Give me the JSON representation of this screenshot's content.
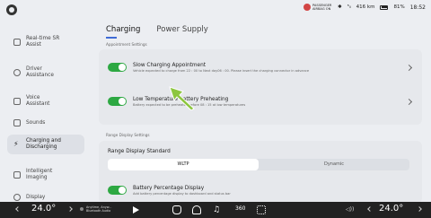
{
  "status": {
    "airbag_line1": "PASSENGER",
    "airbag_line2": "AIRBAG ON",
    "bluetooth": "✱",
    "signal": "⁵ᵢₗ",
    "range": "416 km",
    "battery": "81%",
    "time": "18:52",
    "colors": {
      "airbag": "#d24545"
    }
  },
  "sidebar": {
    "items": [
      {
        "label": "Real-time SR\nAssist",
        "icon": "car-sr-icon"
      },
      {
        "label": "Driver\nAssistance",
        "icon": "steering-wheel-icon"
      },
      {
        "label": "Voice\nAssistant",
        "icon": "voice-assistant-icon"
      },
      {
        "label": "Sounds",
        "icon": "speaker-icon"
      },
      {
        "label": "Charging and\nDischarging",
        "icon": "charging-icon"
      },
      {
        "label": "Intelligent\nImaging",
        "icon": "camera-icon"
      },
      {
        "label": "Display",
        "icon": "brightness-icon"
      }
    ],
    "active_index": 4
  },
  "tabs": [
    {
      "label": "Charging",
      "active": true
    },
    {
      "label": "Power Supply",
      "active": false
    }
  ],
  "appointment": {
    "section_title": "Appointment Settings",
    "slow_title": "Slow Charging Appointment",
    "slow_sub": "Vehicle expected to charge from 22 : 00 to Next day06 : 00. Please insert the charging connector in advance",
    "slow_on": true,
    "preheat_title": "Low Temperature Battery Preheating",
    "preheat_sub": "Battery expected to be preheated before 08 : 15 at low temperatures",
    "preheat_on": true
  },
  "range": {
    "section_title": "Range Display Settings",
    "standard_title": "Range Display Standard",
    "options": [
      "WLTP",
      "Dynamic"
    ],
    "selected": "WLTP",
    "battery_pct_title": "Battery Percentage Display",
    "battery_pct_sub": "Add battery percentage display to dashboard and status bar",
    "battery_pct_on": true
  },
  "bottom": {
    "temp_left": "24.0°",
    "temp_right": "24.0°",
    "media_title": "Anytime, Anyw...",
    "media_sub": "Bluetooth Audio",
    "b360": "360"
  },
  "colors": {
    "accent": "#3f6bd6",
    "toggle_on": "#2da842",
    "arrow": "#8cc63f"
  }
}
